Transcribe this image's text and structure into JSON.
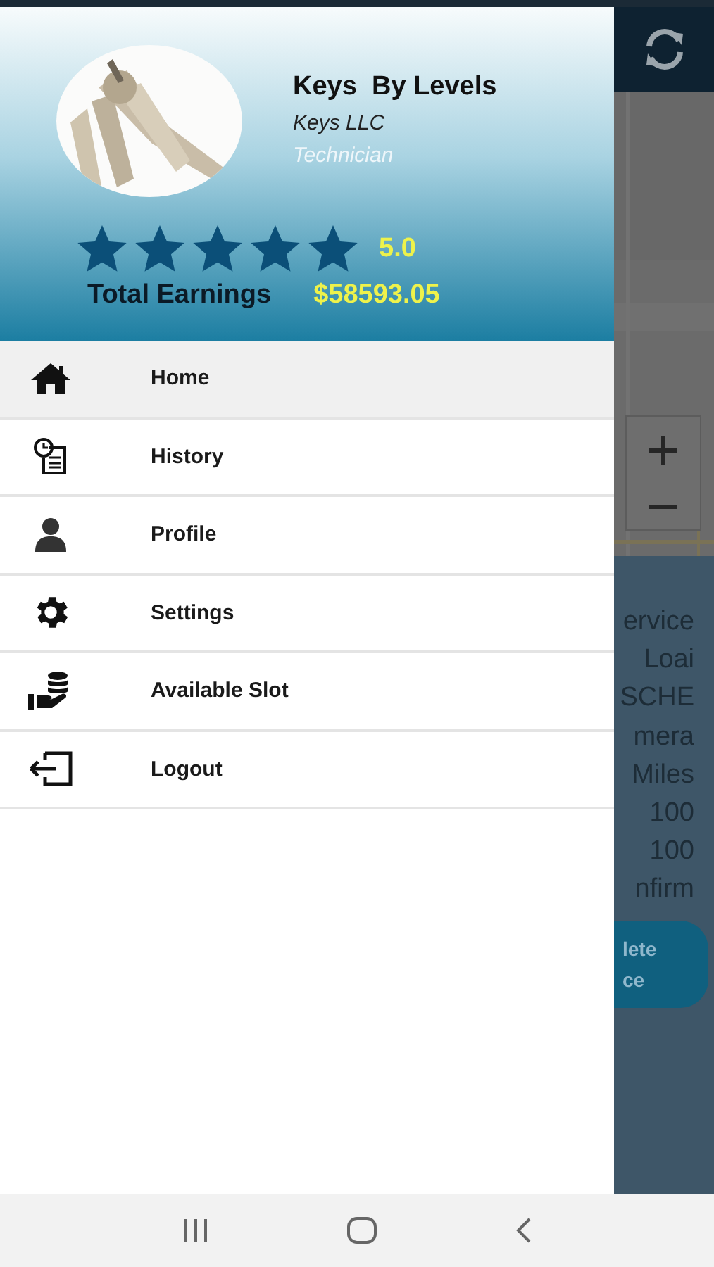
{
  "drawer": {
    "profile": {
      "name": "Keys  By Levels",
      "company": "Keys LLC",
      "role": "Technician",
      "stars": 5,
      "rating": "5.0",
      "earnings_label": "Total Earnings",
      "earnings": "$58593.05"
    },
    "menu": [
      {
        "label": "Home",
        "selected": true
      },
      {
        "label": "History",
        "selected": false
      },
      {
        "label": "Profile",
        "selected": false
      },
      {
        "label": "Settings",
        "selected": false
      },
      {
        "label": "Available Slot",
        "selected": false
      },
      {
        "label": "Logout",
        "selected": false
      }
    ]
  },
  "background": {
    "details": [
      "ervice",
      "Loai",
      "SCHE",
      "mera",
      "Miles",
      "100",
      "100",
      "nfirm"
    ],
    "button": "lete\nce"
  }
}
